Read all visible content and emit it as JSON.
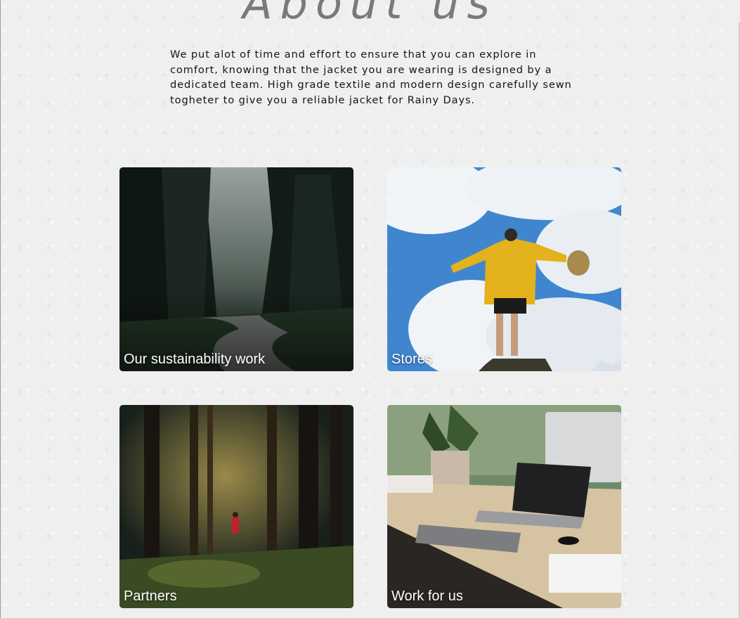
{
  "page": {
    "title": "About us",
    "intro": "We put alot of time and effort to ensure that you can explore in comfort, knowing that the jacket you are wearing is designed by a dedicated team. High grade textile and modern design carefully sewn togheter to give you a reliable jacket for Rainy Days."
  },
  "cards": [
    {
      "label": "Our sustainability work",
      "image": "forest-road-photo"
    },
    {
      "label": "Stores",
      "image": "yellow-raincoat-sky-photo"
    },
    {
      "label": "Partners",
      "image": "hiker-forest-photo"
    },
    {
      "label": "Work for us",
      "image": "office-desk-photo"
    }
  ],
  "colors": {
    "background": "#efefef",
    "title": "#7a7a7a",
    "body_text": "#141414",
    "card_label": "#ffffff",
    "raincoat_yellow": "#e3b21c",
    "sky_blue": "#3f86cf",
    "forest_dark": "#18201b"
  }
}
